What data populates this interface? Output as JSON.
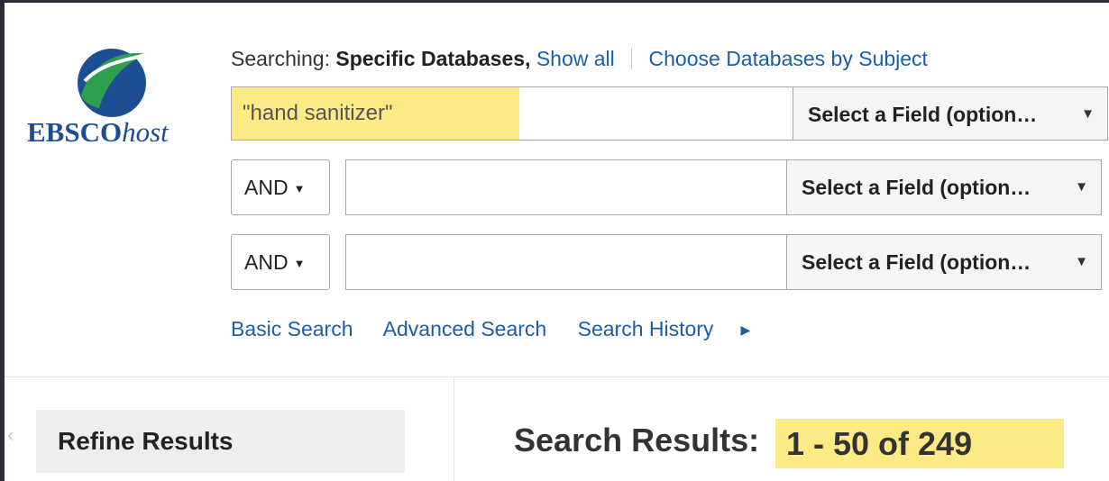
{
  "logo": {
    "brand_bold": "EBSCO",
    "brand_italic": "host"
  },
  "searching": {
    "label": "Searching:",
    "scope": "Specific Databases,",
    "show_all": "Show all",
    "choose_subject": "Choose Databases by Subject"
  },
  "rows": [
    {
      "bool": "",
      "query": "\"hand sanitizer\"",
      "field": "Select a Field (option…"
    },
    {
      "bool": "AND",
      "query": "",
      "field": "Select a Field (option…"
    },
    {
      "bool": "AND",
      "query": "",
      "field": "Select a Field (option…"
    }
  ],
  "links": {
    "basic": "Basic Search",
    "advanced": "Advanced Search",
    "history": "Search History"
  },
  "refine": {
    "label": "Refine Results"
  },
  "results": {
    "title": "Search Results:",
    "count": "1 - 50 of 249"
  },
  "colors": {
    "highlight": "#fceb84",
    "link": "#1a5ea8",
    "brand": "#1d4e94",
    "logo_green": "#2e9e4f"
  }
}
